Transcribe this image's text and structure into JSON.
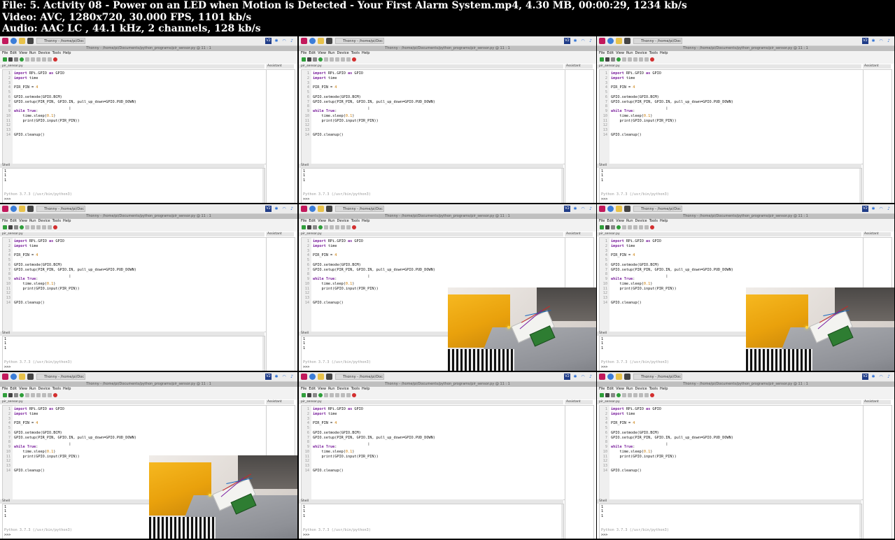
{
  "info": {
    "file_line": "File: 5. Activity 08 - Power on an LED when Motion is Detected - Your First Alarm System.mp4, 4.30 MB, 00:00:29, 1234 kb/s",
    "video_line": "Video: AVC, 1280x720, 30.000 FPS, 1101 kb/s",
    "audio_line": "Audio: AAC LC , 44.1 kHz, 2 channels, 128 kb/s"
  },
  "ide": {
    "taskbar_task": "Thonny - /home/pi/Doc",
    "taskbar_vc": "V2",
    "window_title": "Thonny - /home/pi/Documents/python_programs/pir_sensor.py @ 11 : 1",
    "menu": [
      "File",
      "Edit",
      "View",
      "Run",
      "Device",
      "Tools",
      "Help"
    ],
    "editor_tab": "pir_sensor.py",
    "assistant_tab": "Assistant",
    "shell_tab": "Shell",
    "shell_output": [
      "1",
      "1",
      "1"
    ],
    "shell_version": "Python 3.7.3 (/usr/bin/python3)",
    "shell_prompt": ">>>",
    "code": [
      {
        "n": "1",
        "parts": [
          {
            "t": "import",
            "c": "kw"
          },
          {
            "t": " RPi.GPIO ",
            "c": ""
          },
          {
            "t": "as",
            "c": "kw"
          },
          {
            "t": " GPIO",
            "c": ""
          }
        ]
      },
      {
        "n": "2",
        "parts": [
          {
            "t": "import",
            "c": "kw"
          },
          {
            "t": " time",
            "c": ""
          }
        ]
      },
      {
        "n": "3",
        "parts": []
      },
      {
        "n": "4",
        "parts": [
          {
            "t": "PIR_PIN = ",
            "c": ""
          },
          {
            "t": "4",
            "c": "num"
          }
        ]
      },
      {
        "n": "5",
        "parts": []
      },
      {
        "n": "6",
        "parts": [
          {
            "t": "GPIO.setmode(GPIO.BCM)",
            "c": ""
          }
        ]
      },
      {
        "n": "7",
        "parts": [
          {
            "t": "GPIO.setup(PIR_PIN, GPIO.IN, pull_up_down=GPIO.PUD_DOWN)",
            "c": ""
          }
        ]
      },
      {
        "n": "8",
        "parts": []
      },
      {
        "n": "9",
        "parts": [
          {
            "t": "while",
            "c": "kw"
          },
          {
            "t": " ",
            "c": ""
          },
          {
            "t": "True",
            "c": "kw"
          },
          {
            "t": ":",
            "c": ""
          }
        ]
      },
      {
        "n": "10",
        "parts": [
          {
            "t": "    time.sleep(",
            "c": ""
          },
          {
            "t": "0.1",
            "c": "num"
          },
          {
            "t": ")",
            "c": ""
          }
        ]
      },
      {
        "n": "11",
        "parts": [
          {
            "t": "    print(GPIO.input(PIR_PIN))",
            "c": ""
          }
        ]
      },
      {
        "n": "12",
        "parts": []
      },
      {
        "n": "13",
        "parts": []
      },
      {
        "n": "14",
        "parts": [
          {
            "t": "GPIO.cleanup()",
            "c": ""
          }
        ]
      }
    ]
  },
  "frames": [
    {
      "overlay": false
    },
    {
      "overlay": false
    },
    {
      "overlay": false
    },
    {
      "overlay": false
    },
    {
      "overlay": true
    },
    {
      "overlay": true
    },
    {
      "overlay": true
    },
    {
      "overlay": false
    },
    {
      "overlay": false
    }
  ],
  "colors": {
    "run_green": "#2e9e3a",
    "stop_red": "#d32f2f",
    "keyword": "#7a1f9c",
    "number": "#c97a00"
  }
}
